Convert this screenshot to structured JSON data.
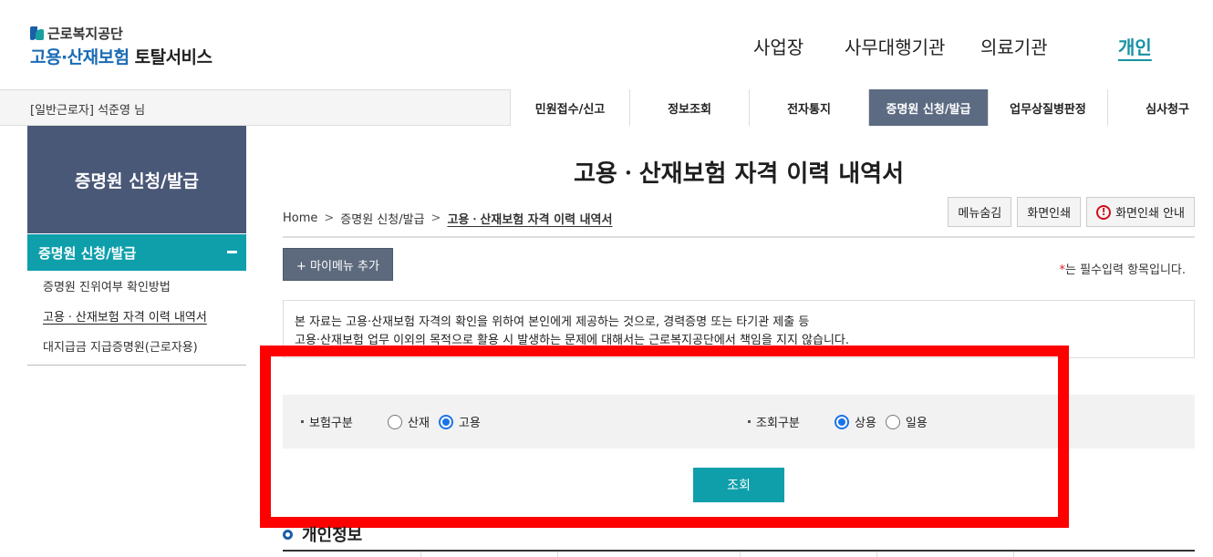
{
  "header": {
    "org_name": "근로복지공단",
    "service_blue": "고용·산재보험",
    "service_dark": "토탈서비스",
    "nav": [
      "사업장",
      "사무대행기관",
      "의료기관",
      "개인"
    ],
    "nav_active": "개인"
  },
  "util_bar": {
    "user": "[일반근로자] 석준영 님",
    "menu": [
      "민원접수/신고",
      "정보조회",
      "전자통지",
      "증명원 신청/발급",
      "업무상질병판정",
      "심사청구"
    ],
    "menu_active": "증명원 신청/발급"
  },
  "sidebar": {
    "title": "증명원 신청/발급",
    "current": "증명원 신청/발급",
    "items": [
      "증명원 진위여부 확인방법",
      "고용ㆍ산재보험 자격 이력 내역서",
      "대지급금 지급증명원(근로자용)"
    ]
  },
  "page": {
    "title": "고용ㆍ산재보험 자격 이력 내역서",
    "breadcrumb": [
      "Home",
      "증명원 신청/발급",
      "고용ㆍ산재보험 자격 이력 내역서"
    ],
    "util_buttons": [
      "메뉴숨김",
      "화면인쇄",
      "화면인쇄 안내"
    ],
    "mymenu_button": "+ 마이메뉴 추가",
    "required_star": "*",
    "required_note": "는 필수입력 항목입니다.",
    "notice_lines": [
      "본 자료는 고용·산재보험 자격의 확인을 위하여 본인에게 제공하는 것으로, 경력증명 또는 타기관 제출 등",
      "고용·산재보험 업무 이외의 목적으로 활용 시 발생하는 문제에 대해서는 근로복지공단에서 책임을 지지 않습니다."
    ],
    "search": {
      "insurance_label": "보험구분",
      "insurance_options": [
        "산재",
        "고용"
      ],
      "insurance_selected": "고용",
      "query_label": "조회구분",
      "query_options": [
        "상용",
        "일용"
      ],
      "query_selected": "상용",
      "submit": "조회"
    },
    "section_title": "개인정보"
  },
  "colors": {
    "accent_teal": "#0e9fab",
    "navy": "#4a5878",
    "highlight": "#ff0000"
  }
}
